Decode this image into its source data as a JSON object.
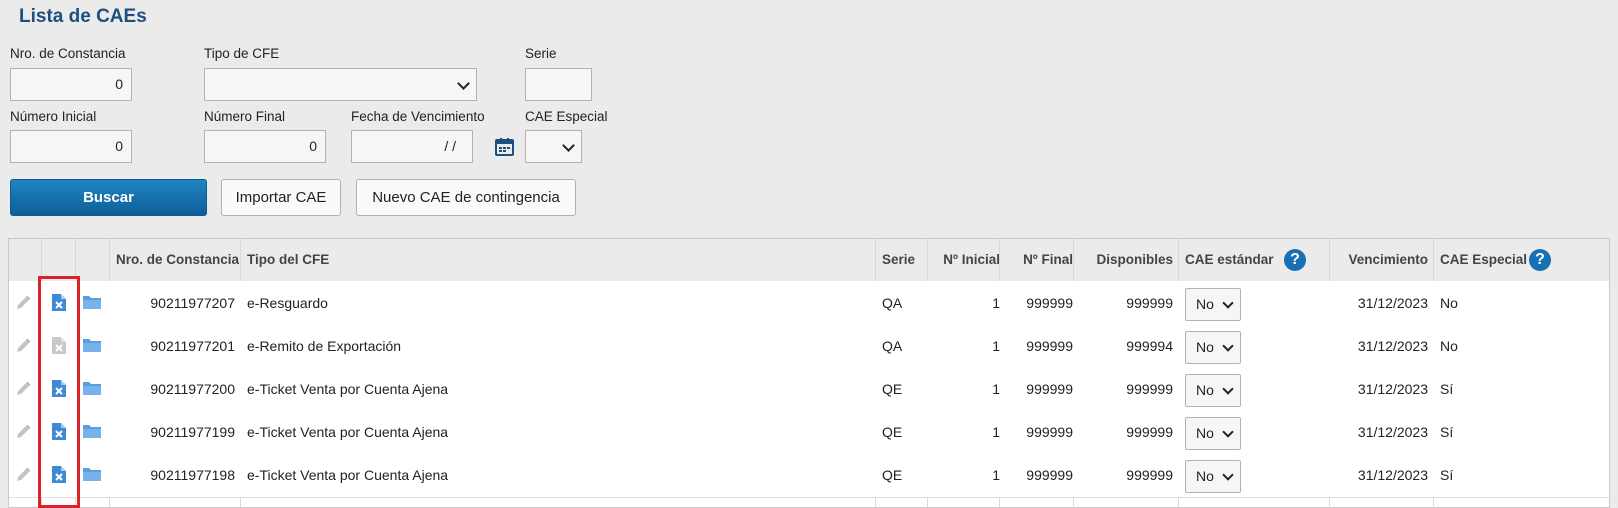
{
  "page": {
    "title": "Lista de CAEs"
  },
  "filters": {
    "nro_constancia": {
      "label": "Nro. de Constancia",
      "value": "0"
    },
    "tipo_cfe": {
      "label": "Tipo de CFE",
      "value": ""
    },
    "serie": {
      "label": "Serie",
      "value": ""
    },
    "numero_inicial": {
      "label": "Número Inicial",
      "value": "0"
    },
    "numero_final": {
      "label": "Número Final",
      "value": "0"
    },
    "fecha_vencimiento": {
      "label": "Fecha de Vencimiento",
      "value": "/  /"
    },
    "cae_especial": {
      "label": "CAE Especial",
      "value": ""
    }
  },
  "buttons": {
    "buscar": "Buscar",
    "importar": "Importar CAE",
    "nuevo": "Nuevo CAE de contingencia"
  },
  "table": {
    "headers": {
      "nro": "Nro. de Constancia",
      "tipo": "Tipo del CFE",
      "serie": "Serie",
      "inicial": "Nº Inicial",
      "final": "Nº Final",
      "disponibles": "Disponibles",
      "estandar": "CAE estándar",
      "vencimiento": "Vencimiento",
      "especial": "CAE Especial",
      "help": "?"
    },
    "rows": [
      {
        "nro": "90211977207",
        "tipo": "e-Resguardo",
        "serie": "QA",
        "inicial": "1",
        "final": "999999",
        "disponibles": "999999",
        "estandar": "No",
        "vencimiento": "31/12/2023",
        "especial": "No",
        "delete_enabled": true
      },
      {
        "nro": "90211977201",
        "tipo": "e-Remito de Exportación",
        "serie": "QA",
        "inicial": "1",
        "final": "999999",
        "disponibles": "999994",
        "estandar": "No",
        "vencimiento": "31/12/2023",
        "especial": "No",
        "delete_enabled": false
      },
      {
        "nro": "90211977200",
        "tipo": "e-Ticket Venta por Cuenta Ajena",
        "serie": "QE",
        "inicial": "1",
        "final": "999999",
        "disponibles": "999999",
        "estandar": "No",
        "vencimiento": "31/12/2023",
        "especial": "Sí",
        "delete_enabled": true
      },
      {
        "nro": "90211977199",
        "tipo": "e-Ticket Venta por Cuenta Ajena",
        "serie": "QE",
        "inicial": "1",
        "final": "999999",
        "disponibles": "999999",
        "estandar": "No",
        "vencimiento": "31/12/2023",
        "especial": "Sí",
        "delete_enabled": true
      },
      {
        "nro": "90211977198",
        "tipo": "e-Ticket Venta por Cuenta Ajena",
        "serie": "QE",
        "inicial": "1",
        "final": "999999",
        "disponibles": "999999",
        "estandar": "No",
        "vencimiento": "31/12/2023",
        "especial": "Sí",
        "delete_enabled": true
      }
    ]
  },
  "colors": {
    "accent": "#1670b3",
    "title": "#1d4f80",
    "highlight": "#d8232a"
  },
  "icons": {
    "edit": "pencil-icon",
    "delete": "delete-file-icon",
    "open": "folder-icon",
    "calendar": "calendar-icon",
    "help": "help-icon"
  }
}
